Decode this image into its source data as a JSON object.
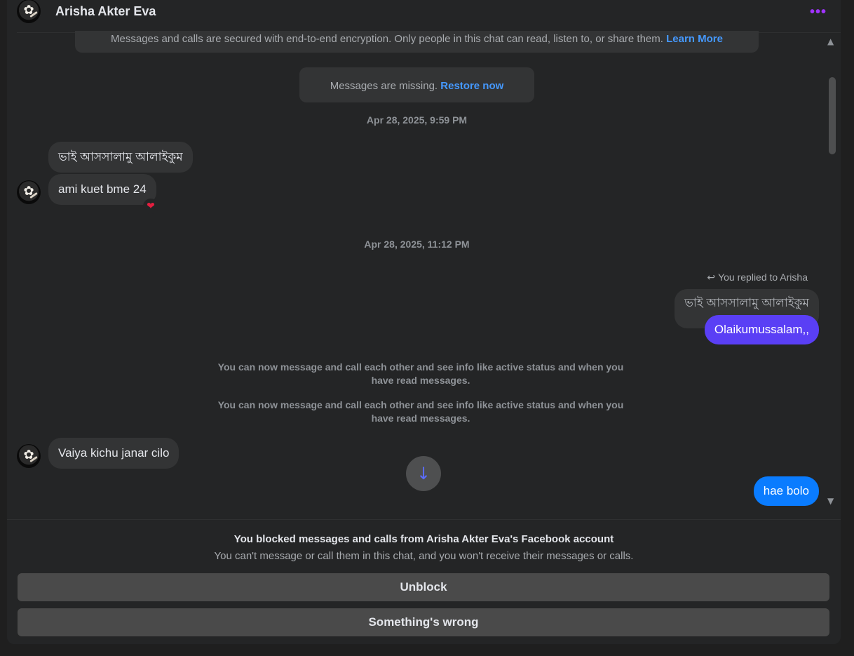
{
  "header": {
    "name": "Arisha Akter Eva",
    "more_icon": "more-horizontal-icon",
    "accent": "#a033ff"
  },
  "notices": {
    "encryption_text": "Messages and calls are secured with end-to-end encryption. Only people in this chat can read, listen to, or share them. ",
    "encryption_link": "Learn More",
    "missing_text": "Messages are missing. ",
    "missing_link": "Restore now"
  },
  "timestamps": [
    "Apr 28, 2025, 9:59 PM",
    "Apr 28, 2025, 11:12 PM"
  ],
  "messages": {
    "in1": "ভাই আসসালামু আলাইকুম",
    "in2": "ami kuet bme 24",
    "in2_reaction": "❤",
    "replied_label": "You replied to Arisha",
    "reply_quote": "ভাই আসসালামু আলাইকুম",
    "out1": "Olaikumussalam,,",
    "info1": "You can now message and call each other and see info like active status and when you have read messages.",
    "info2": "You can now message and call each other and see info like active status and when you have read messages.",
    "in3": "Vaiya kichu janar cilo",
    "out2": "hae bolo"
  },
  "colors": {
    "out1_bg": "#5a3ff5",
    "out2_bg": "#0a7cff"
  },
  "blocked": {
    "title": "You blocked messages and calls from Arisha Akter Eva's Facebook account",
    "subtitle": "You can't message or call them in this chat, and you won't receive their messages or calls.",
    "unblock": "Unblock",
    "wrong": "Something's wrong"
  }
}
